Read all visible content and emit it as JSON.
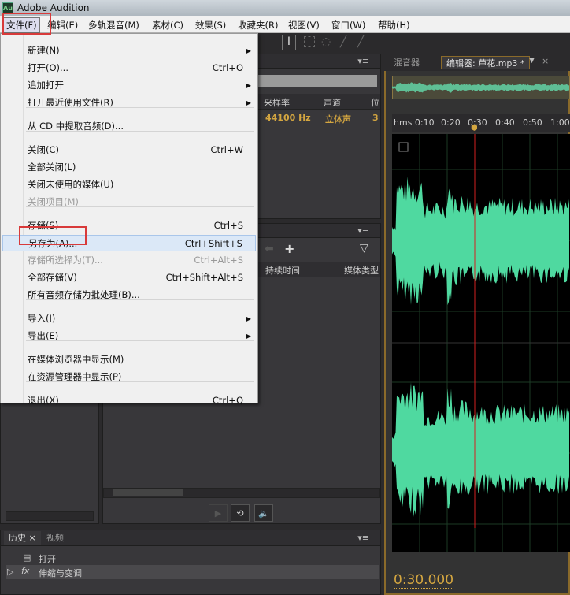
{
  "app": {
    "title": "Adobe Audition",
    "icon": "Au"
  },
  "menubar": [
    "文件(F)",
    "编辑(E)",
    "多轨混音(M)",
    "素材(C)",
    "效果(S)",
    "收藏夹(R)",
    "视图(V)",
    "窗口(W)",
    "帮助(H)"
  ],
  "file_menu": [
    {
      "label": "新建(N)",
      "submenu": true
    },
    {
      "label": "打开(O)...",
      "shortcut": "Ctrl+O"
    },
    {
      "label": "追加打开",
      "submenu": true
    },
    {
      "label": "打开最近使用文件(R)",
      "submenu": true
    },
    {
      "label": "从 CD 中提取音频(D)..."
    },
    {
      "label": "关闭(C)",
      "shortcut": "Ctrl+W"
    },
    {
      "label": "全部关闭(L)"
    },
    {
      "label": "关闭未使用的媒体(U)"
    },
    {
      "label": "关闭项目(M)",
      "disabled": true
    },
    {
      "label": "存储(S)",
      "shortcut": "Ctrl+S"
    },
    {
      "label": "另存为(A)...",
      "shortcut": "Ctrl+Shift+S",
      "highlighted": true
    },
    {
      "label": "存储所选择为(T)...",
      "shortcut": "Ctrl+Alt+S",
      "disabled": true
    },
    {
      "label": "全部存储(V)",
      "shortcut": "Ctrl+Shift+Alt+S"
    },
    {
      "label": "所有音频存储为批处理(B)..."
    },
    {
      "label": "导入(I)",
      "submenu": true
    },
    {
      "label": "导出(E)",
      "submenu": true
    },
    {
      "label": "在媒体浏览器中显示(M)"
    },
    {
      "label": "在资源管理器中显示(P)"
    },
    {
      "label": "退出(X)",
      "shortcut": "Ctrl+Q"
    }
  ],
  "files_panel": {
    "columns": [
      "采样率",
      "声道",
      "位"
    ],
    "row": [
      "44100 Hz",
      "立体声",
      "3"
    ]
  },
  "media_panel": {
    "columns": [
      "持续时间",
      "媒体类型"
    ]
  },
  "editor": {
    "tabs": [
      "混音器",
      "编辑器: 芦花.mp3 *"
    ],
    "ruler": [
      "hms 0:10",
      "0:20",
      "0:30",
      "0:40",
      "0:50",
      "1:00"
    ],
    "time": "0:30.000"
  },
  "history": {
    "tabs": [
      "历史",
      "视频"
    ],
    "items": [
      "打开",
      "伸缩与变调"
    ]
  },
  "colors": {
    "wave": "#4fd9a0",
    "playhead": "#d42020",
    "timecode": "#d4a640"
  }
}
